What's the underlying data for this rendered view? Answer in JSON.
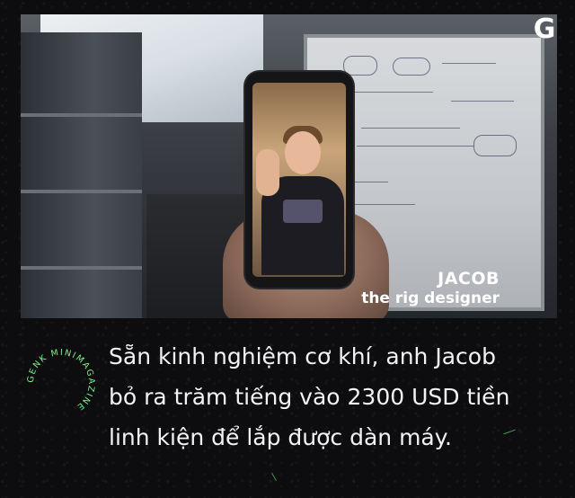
{
  "logo": {
    "letter": "G"
  },
  "photo": {
    "caption_name": "JACOB",
    "caption_role": "the rig designer"
  },
  "badge": {
    "text": "GENK MINIMAGAZINE"
  },
  "body": {
    "lines": [
      "Sẵn kinh nghiệm cơ khí, anh Jacob",
      "bỏ ra trăm tiếng vào 2300 USD tiền",
      "linh kiện để lắp được dàn máy."
    ]
  },
  "colors": {
    "background": "#0d0d0f",
    "text": "#f2f2f2",
    "badge_ring": "#7cf08a"
  }
}
